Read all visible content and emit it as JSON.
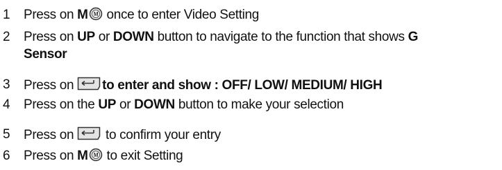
{
  "steps": [
    {
      "number": "1",
      "before": "Press on ",
      "key": "M",
      "icon": "mode-button-icon",
      "after": " once to enter Video Setting"
    },
    {
      "number": "2",
      "before": "Press on ",
      "up": "UP",
      "or": " or ",
      "down": "DOWN",
      "after": " button to navigate to the function that shows ",
      "target_line1": "G",
      "target_line2": "Sensor"
    },
    {
      "number": "3",
      "before": "Press on ",
      "icon": "enter-button-icon",
      "after": "to enter and show : OFF/ LOW/ MEDIUM/ HIGH"
    },
    {
      "number": "4",
      "before": "Press on the ",
      "up": "UP",
      "or": " or ",
      "down": "DOWN",
      "after": " button to make your selection"
    },
    {
      "number": "5",
      "before": "Press on ",
      "icon": "enter-button-icon",
      "after": " to confirm your entry"
    },
    {
      "number": "6",
      "before": "Press on ",
      "key": "M",
      "icon": "mode-button-icon",
      "after": " to exit Setting"
    }
  ],
  "icon_labels": {
    "mode": "M"
  },
  "colors": {
    "text": "#111111",
    "icon_fill": "#e4e4e4",
    "icon_stroke": "#333333"
  }
}
